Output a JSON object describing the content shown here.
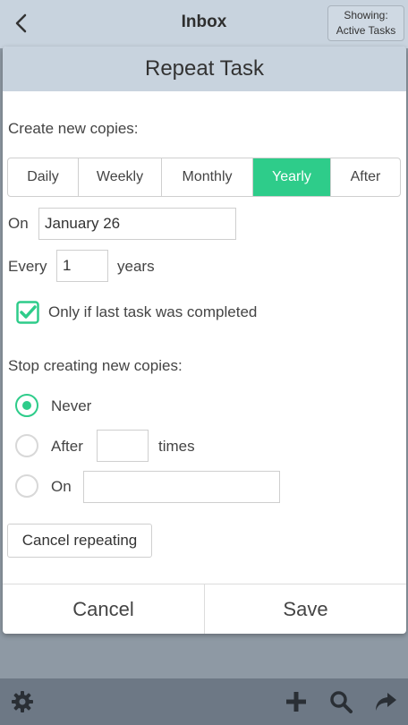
{
  "topbar": {
    "title": "Inbox",
    "back_icon": "chevron-left-icon",
    "showing_line1": "Showing:",
    "showing_line2": "Active Tasks"
  },
  "dialog": {
    "title": "Repeat Task",
    "create_label": "Create new copies:",
    "frequency_options": [
      "Daily",
      "Weekly",
      "Monthly",
      "Yearly",
      "After"
    ],
    "selected_frequency": "Yearly",
    "on_label": "On",
    "on_value": "January 26",
    "every_label": "Every",
    "every_value": "1",
    "every_unit": "years",
    "only_if_completed_label": "Only if last task was completed",
    "only_if_completed_checked": true,
    "stop_label": "Stop creating new copies:",
    "stop_options": {
      "never": "Never",
      "after": "After",
      "after_unit": "times",
      "after_value": "",
      "on": "On",
      "on_value": ""
    },
    "stop_selected": "Never",
    "cancel_repeating_label": "Cancel repeating",
    "cancel_label": "Cancel",
    "save_label": "Save"
  },
  "bottombar": {
    "icons": [
      "gear-icon",
      "plus-icon",
      "search-icon",
      "share-icon"
    ]
  },
  "colors": {
    "accent": "#2ecc8a",
    "header_bg": "#c8d3de",
    "bottombar_bg": "#6d7885",
    "overlay_bg": "#8e99a4"
  }
}
